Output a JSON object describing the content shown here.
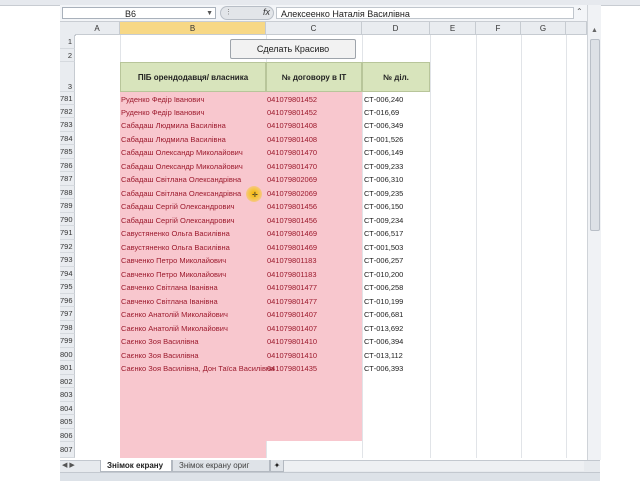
{
  "formula_bar": {
    "cell_ref": "B6",
    "formula_value": "Алексеенко Наталія Василівна",
    "fx_label": "fx"
  },
  "columns": [
    "A",
    "B",
    "C",
    "D",
    "E",
    "F",
    "G"
  ],
  "rows_top": [
    "1",
    "2",
    "3"
  ],
  "button_label": "Сделать Красиво",
  "headers": {
    "col_b": "ПІБ орендодавця/ власника",
    "col_c": "№ договору в ІТ",
    "col_d": "№ діл."
  },
  "rows": [
    {
      "num": "781",
      "name": "Руденко Федір Іванович",
      "contract": "041079801452",
      "plot": "СТ-006,240"
    },
    {
      "num": "782",
      "name": "Руденко Федір Іванович",
      "contract": "041079801452",
      "plot": "СТ-016,69"
    },
    {
      "num": "783",
      "name": "Сабадаш Людмила Василівна",
      "contract": "041079801408",
      "plot": "СТ-006,349"
    },
    {
      "num": "784",
      "name": "Сабадаш Людмила Василівна",
      "contract": "041079801408",
      "plot": "СТ-001,526"
    },
    {
      "num": "785",
      "name": "Сабадаш Олександр Миколайович",
      "contract": "041079801470",
      "plot": "СТ-006,149"
    },
    {
      "num": "786",
      "name": "Сабадаш Олександр Миколайович",
      "contract": "041079801470",
      "plot": "СТ-009,233"
    },
    {
      "num": "787",
      "name": "Сабадаш Світлана Олександрівна",
      "contract": "041079802069",
      "plot": "СТ-006,310"
    },
    {
      "num": "788",
      "name": "Сабадаш Світлана Олександрівна",
      "contract": "041079802069",
      "plot": "СТ-009,235"
    },
    {
      "num": "789",
      "name": "Сабадаш Сергій Олександрович",
      "contract": "041079801456",
      "plot": "СТ-006,150"
    },
    {
      "num": "790",
      "name": "Сабадаш Сергій Олександрович",
      "contract": "041079801456",
      "plot": "СТ-009,234"
    },
    {
      "num": "791",
      "name": "Савустяненко Ольга Василівна",
      "contract": "041079801469",
      "plot": "СТ-006,517"
    },
    {
      "num": "792",
      "name": "Савустяненко Ольга Василівна",
      "contract": "041079801469",
      "plot": "СТ-001,503"
    },
    {
      "num": "793",
      "name": "Савченко Петро Миколайович",
      "contract": "041079801183",
      "plot": "СТ-006,257"
    },
    {
      "num": "794",
      "name": "Савченко Петро Миколайович",
      "contract": "041079801183",
      "plot": "СТ-010,200"
    },
    {
      "num": "795",
      "name": "Савченко Світлана Іванівна",
      "contract": "041079801477",
      "plot": "СТ-006,258"
    },
    {
      "num": "796",
      "name": "Савченко Світлана Іванівна",
      "contract": "041079801477",
      "plot": "СТ-010,199"
    },
    {
      "num": "797",
      "name": "Саєнко Анатолій Миколайович",
      "contract": "041079801407",
      "plot": "СТ-006,681"
    },
    {
      "num": "798",
      "name": "Саєнко Анатолій Миколайович",
      "contract": "041079801407",
      "plot": "СТ-013,692"
    },
    {
      "num": "799",
      "name": "Саєнко Зоя Василівна",
      "contract": "041079801410",
      "plot": "СТ-006,394"
    },
    {
      "num": "800",
      "name": "Саєнко Зоя Василівна",
      "contract": "041079801410",
      "plot": "СТ-013,112"
    },
    {
      "num": "801",
      "name": "Саєнко Зоя Василівна, Дон Таїса Василівна",
      "contract": "041079801435",
      "plot": "СТ-006,393"
    }
  ],
  "empty_rows": [
    "802",
    "803",
    "804",
    "805",
    "806",
    "807"
  ],
  "sheet_tabs": {
    "active": "Знімок екрану",
    "other": "Знімок екрану ориг"
  },
  "colors": {
    "pink_fill": "#f8c7ce",
    "pink_text": "#9c1a2d",
    "header_green": "#d8e4bc",
    "selected_col": "#f7d886"
  }
}
